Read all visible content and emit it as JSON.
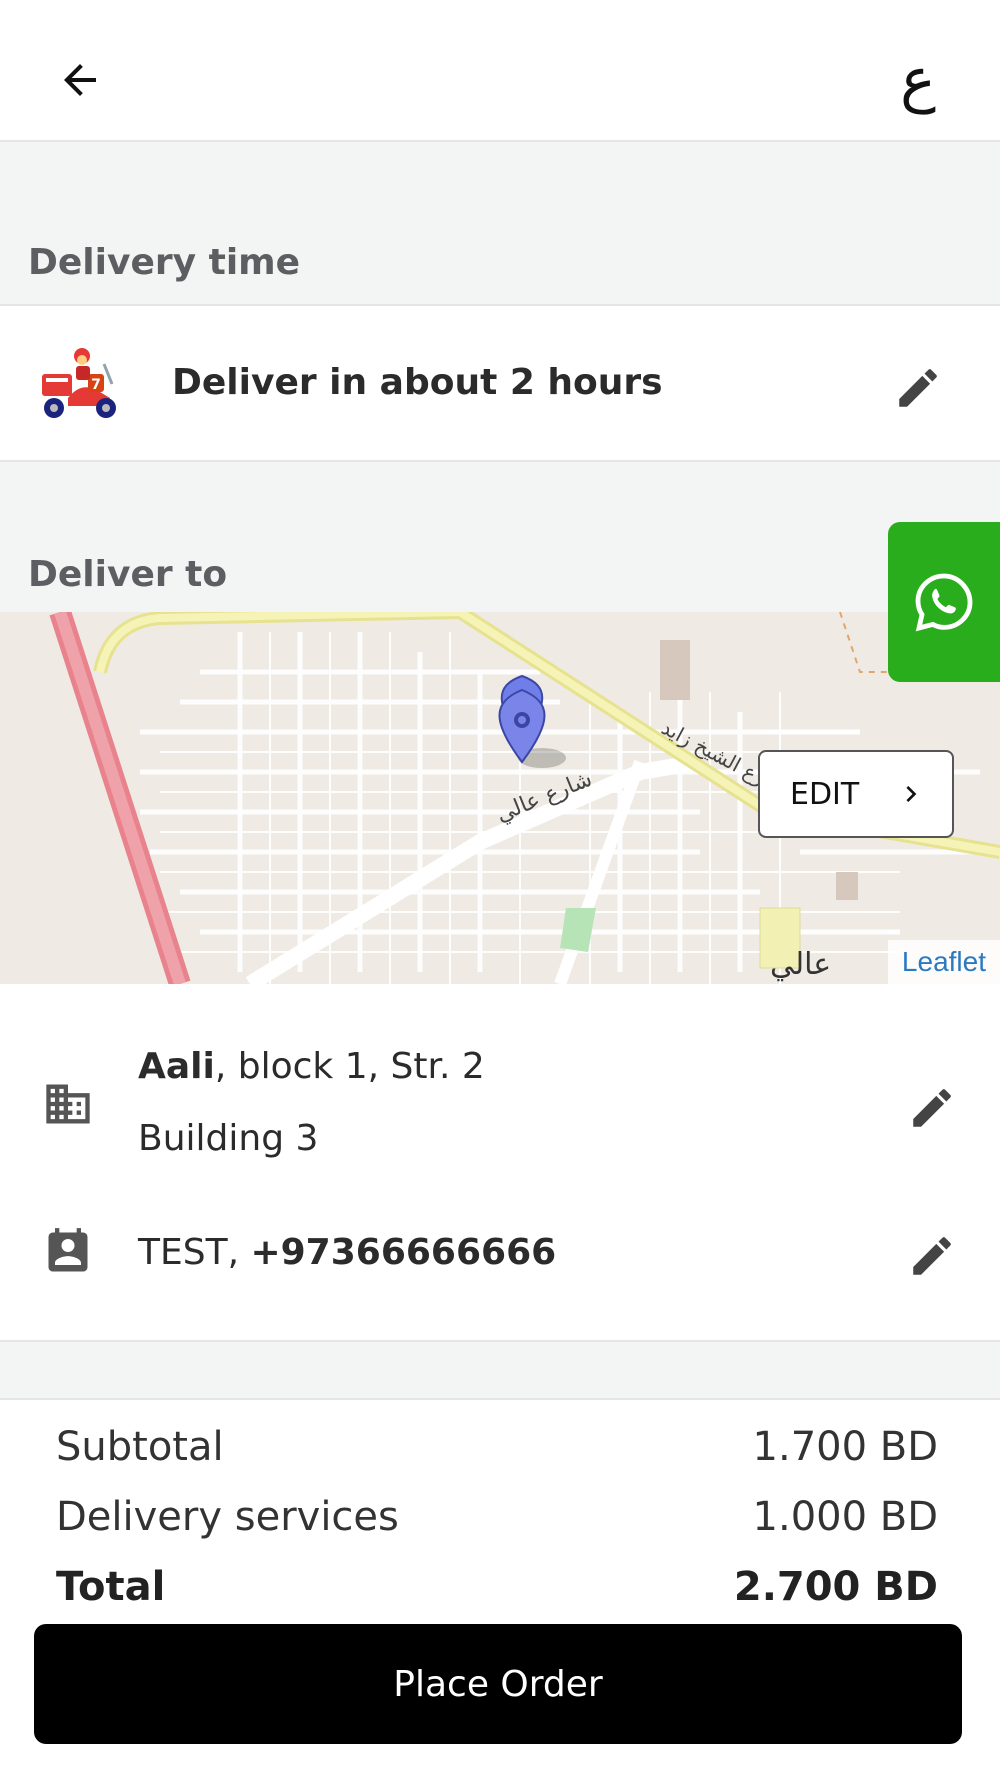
{
  "header": {
    "back_icon": "arrow-left-icon",
    "language_toggle": "ع"
  },
  "delivery_time": {
    "section_label": "Delivery time",
    "icon": "delivery-scooter-icon",
    "value": "Deliver in about 2 hours",
    "edit_icon": "pencil-icon"
  },
  "deliver_to": {
    "section_label": "Deliver to",
    "map": {
      "edit_label": "EDIT",
      "attribution": "Leaflet",
      "marker_icon": "map-pin-icon"
    },
    "address": {
      "area": "Aali",
      "line1_rest": ", block 1, Str. 2",
      "line2": "Building 3",
      "icon": "building-icon"
    },
    "contact": {
      "name": "TEST, ",
      "phone": "+97366666666",
      "icon": "contact-card-icon"
    }
  },
  "whatsapp": {
    "icon": "whatsapp-icon",
    "color": "#2aad1c"
  },
  "totals": {
    "subtotal_label": "Subtotal",
    "subtotal_value": "1.700 BD",
    "delivery_label": "Delivery services",
    "delivery_value": "1.000 BD",
    "total_label": "Total",
    "total_value": "2.700 BD"
  },
  "place_order_label": "Place Order"
}
